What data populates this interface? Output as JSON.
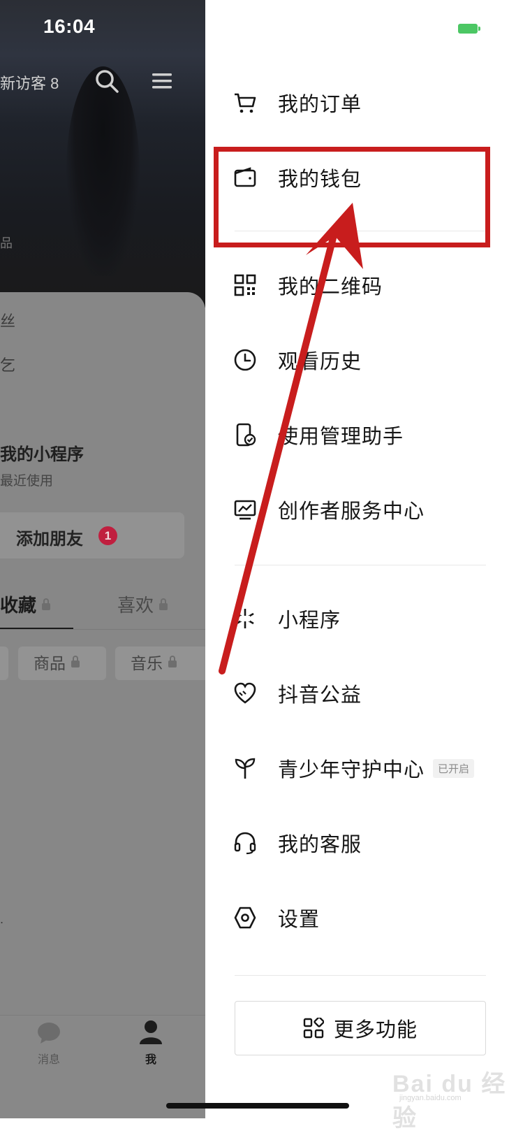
{
  "status_bar": {
    "time": "16:04",
    "battery_color": "#4cc764"
  },
  "profile": {
    "visitors_label": "新访客 8",
    "fragments": {
      "fans": "丝",
      "edit": "乞",
      "side": "品",
      "bottom_side": "."
    },
    "mini_program": {
      "title": "我的小程序",
      "subtitle": "最近使用"
    },
    "add_friend": {
      "label": "添加朋友",
      "badge": "1"
    },
    "tabs": [
      {
        "label": "收藏",
        "locked": true,
        "active": true
      },
      {
        "label": "喜欢",
        "locked": true,
        "active": false
      }
    ],
    "chips": [
      {
        "label": "商品",
        "locked": true
      },
      {
        "label": "音乐",
        "locked": true
      }
    ],
    "bottom_nav": [
      {
        "label": "消息",
        "icon": "message-bubble-icon"
      },
      {
        "label": "我",
        "icon": "person-icon"
      }
    ]
  },
  "drawer": {
    "items": [
      {
        "label": "我的订单",
        "icon": "cart-icon"
      },
      {
        "label": "我的钱包",
        "icon": "wallet-icon"
      },
      {
        "label": "我的二维码",
        "icon": "qrcode-icon"
      },
      {
        "label": "观看历史",
        "icon": "clock-icon"
      },
      {
        "label": "使用管理助手",
        "icon": "phone-check-icon"
      },
      {
        "label": "创作者服务中心",
        "icon": "monitor-chart-icon"
      },
      {
        "label": "小程序",
        "icon": "miniprogram-icon"
      },
      {
        "label": "抖音公益",
        "icon": "heart-hands-icon"
      },
      {
        "label": "青少年守护中心",
        "icon": "sprout-icon",
        "tag": "已开启"
      },
      {
        "label": "我的客服",
        "icon": "headset-icon"
      },
      {
        "label": "设置",
        "icon": "hexagon-settings-icon"
      }
    ],
    "more_button": {
      "label": "更多功能",
      "icon": "grid-icon"
    }
  },
  "annotation": {
    "color": "#c81d1d",
    "highlighted_item": "我的钱包"
  },
  "watermark": {
    "text": "Bai du 经验",
    "sub": "jingyan.baidu.com"
  }
}
